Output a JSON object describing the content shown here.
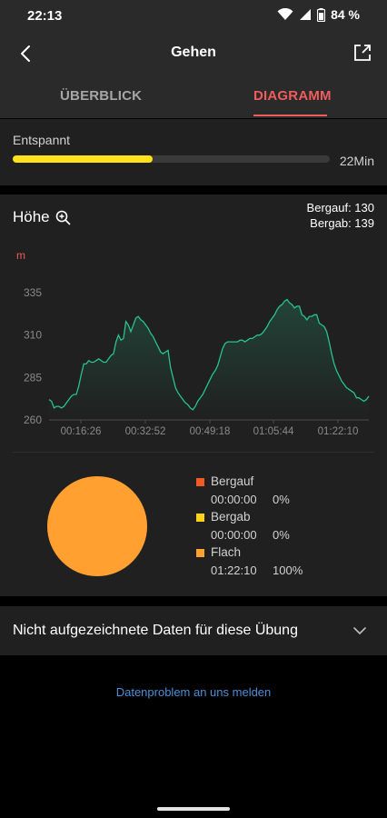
{
  "status_bar": {
    "time": "22:13",
    "battery": "84 %"
  },
  "header": {
    "title": "Gehen"
  },
  "tabs": [
    {
      "label": "ÜBERBLICK",
      "active": false
    },
    {
      "label": "DIAGRAMM",
      "active": true
    }
  ],
  "relax": {
    "label": "Entspannt",
    "value": "22Min",
    "progress_percent": 44,
    "bar_color": "#ffe21a"
  },
  "elevation": {
    "title": "Höhe",
    "ascent": "Bergauf: 130",
    "descent": "Bergab: 139",
    "unit": "m",
    "chart_data": {
      "type": "line",
      "series": [
        {
          "values": [
            272,
            271,
            267,
            268,
            268,
            267,
            268,
            270,
            272,
            274,
            275,
            275,
            280,
            287,
            293,
            293,
            295,
            294,
            294,
            295,
            296,
            295,
            294,
            294,
            296,
            298,
            299,
            306,
            310,
            307,
            308,
            318,
            316,
            312,
            316,
            320,
            321,
            319,
            318,
            316,
            314,
            311,
            309,
            306,
            303,
            300,
            299,
            300,
            301,
            291,
            285,
            279,
            276,
            274,
            272,
            270,
            269,
            267,
            266,
            268,
            271,
            273,
            275,
            278,
            281,
            284,
            287,
            289,
            292,
            297,
            302,
            305,
            306,
            306,
            306,
            306,
            306,
            307,
            307,
            306,
            307,
            308,
            308,
            309,
            310,
            310,
            311,
            313,
            315,
            318,
            320,
            322,
            325,
            327,
            328,
            330,
            331,
            329,
            328,
            326,
            327,
            327,
            322,
            321,
            319,
            321,
            321,
            322,
            322,
            317,
            316,
            315,
            312,
            306,
            299,
            293,
            289,
            286,
            283,
            281,
            279,
            278,
            277,
            276,
            273,
            273,
            272,
            271,
            272,
            274
          ],
          "color": "#28c28e"
        }
      ],
      "x_tick_labels": [
        "00:16:26",
        "00:32:52",
        "00:49:18",
        "01:05:44",
        "01:22:10"
      ],
      "y_tick_labels": [
        "335",
        "310",
        "285",
        "260"
      ],
      "y_ticks": [
        335,
        310,
        285,
        260
      ],
      "ylim": [
        260,
        335
      ]
    },
    "distribution": {
      "pie_color": "#ffa030",
      "items": [
        {
          "name": "Bergauf",
          "time": "00:00:00",
          "percent": "0%",
          "color": "#f15a22"
        },
        {
          "name": "Bergab",
          "time": "00:00:00",
          "percent": "0%",
          "color": "#ffd21a"
        },
        {
          "name": "Flach",
          "time": "01:22:10",
          "percent": "100%",
          "color": "#ffa030"
        }
      ]
    }
  },
  "missing_data": {
    "label": "Nicht aufgezeichnete Daten für diese Übung"
  },
  "report_link": "Datenproblem an uns melden"
}
